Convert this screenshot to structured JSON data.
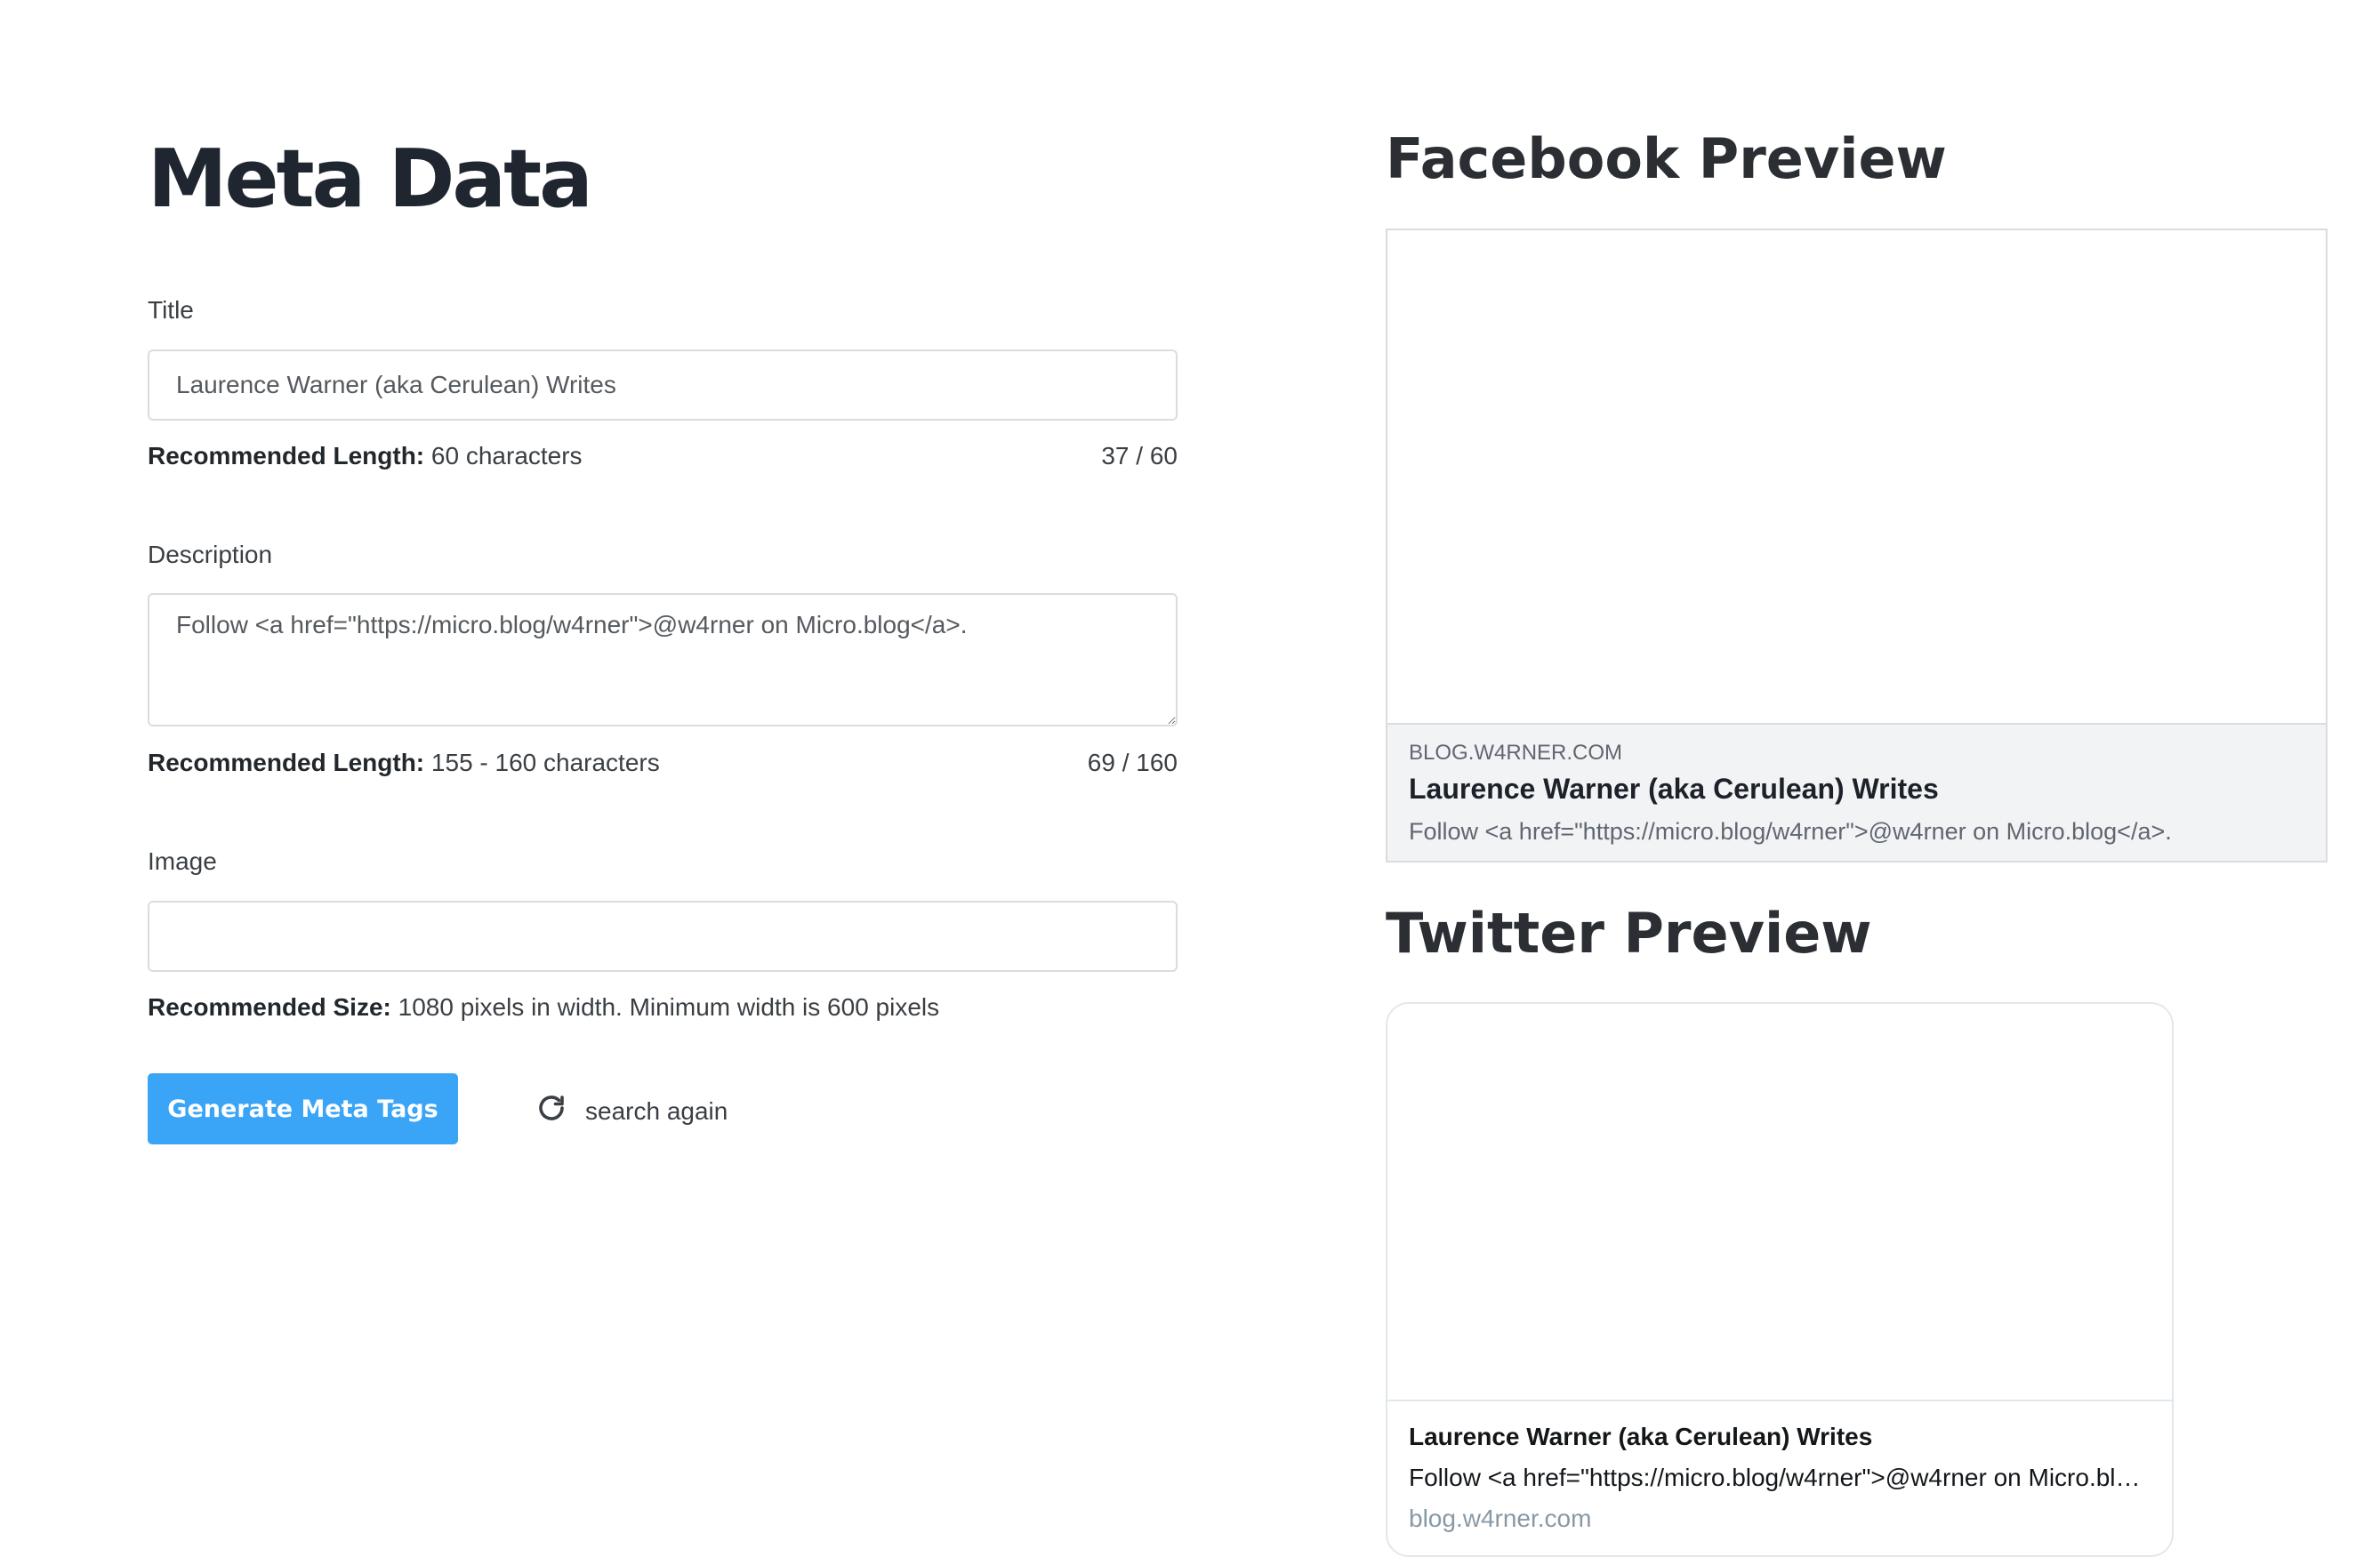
{
  "form": {
    "title": "Meta Data",
    "title_field": {
      "label": "Title",
      "value": "Laurence Warner (aka Cerulean) Writes",
      "hint_bold": "Recommended Length:",
      "hint_text": " 60 characters",
      "counter": "37 / 60"
    },
    "description_field": {
      "label": "Description",
      "value": "Follow <a href=\"https://micro.blog/w4rner\">@w4rner on Micro.blog</a>.",
      "hint_bold": "Recommended Length:",
      "hint_text": " 155 - 160 characters",
      "counter": "69 / 160"
    },
    "image_field": {
      "label": "Image",
      "value": "",
      "hint_bold": "Recommended Size:",
      "hint_text": " 1080 pixels in width. Minimum width is 600 pixels"
    },
    "generate_button": "Generate Meta Tags",
    "reset_link": "search again",
    "reset_icon": "refresh-icon"
  },
  "facebook": {
    "heading": "Facebook Preview",
    "domain": "BLOG.W4RNER.COM",
    "title": "Laurence Warner (aka Cerulean) Writes",
    "description": "Follow <a href=\"https://micro.blog/w4rner\">@w4rner on Micro.blog</a>."
  },
  "twitter": {
    "heading": "Twitter Preview",
    "title": "Laurence Warner (aka Cerulean) Writes",
    "description": "Follow <a href=\"https://micro.blog/w4rner\">@w4rner on Micro.blog</a>.",
    "domain": "blog.w4rner.com"
  },
  "colors": {
    "primary": "#3aa4f7",
    "border": "#dadde0",
    "facebook_meta_bg": "#f2f3f5",
    "twitter_domain": "#8899a6"
  }
}
